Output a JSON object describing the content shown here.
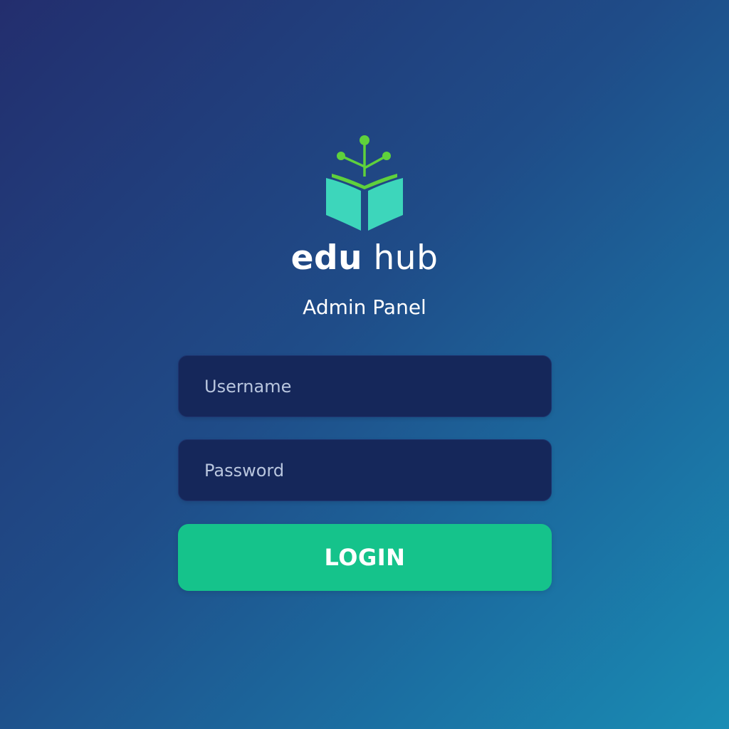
{
  "brand": {
    "logo_icon": "book-with-sprout-icon",
    "name_part1": "edu",
    "name_part2": "hub",
    "subtitle": "Admin Panel"
  },
  "form": {
    "username_placeholder": "Username",
    "username_value": "",
    "password_placeholder": "Password",
    "password_value": "",
    "login_label": "LOGIN"
  },
  "colors": {
    "background_start": "#232e6e",
    "background_end": "#1a8db4",
    "field_background": "#15275a",
    "accent": "#15c38b",
    "logo_book": "#3dd6bb",
    "logo_sprout": "#5fd13c"
  }
}
